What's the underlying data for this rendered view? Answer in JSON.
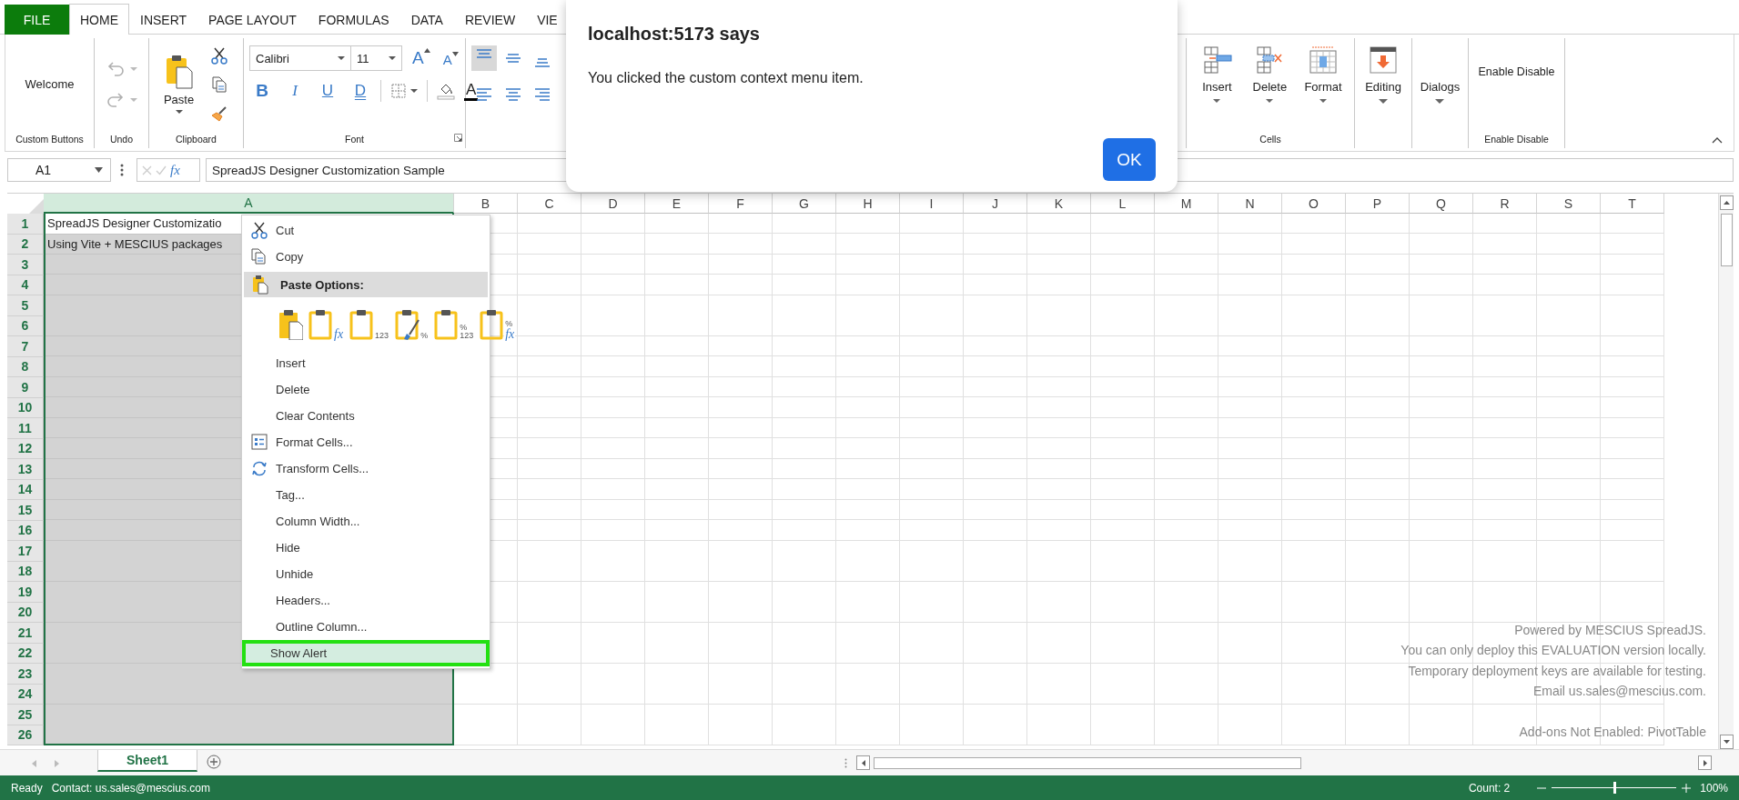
{
  "tabs": [
    {
      "label": "FILE",
      "kind": "file",
      "selected": false
    },
    {
      "label": "HOME",
      "kind": "tab",
      "selected": true
    },
    {
      "label": "INSERT",
      "kind": "tab",
      "selected": false
    },
    {
      "label": "PAGE LAYOUT",
      "kind": "tab",
      "selected": false
    },
    {
      "label": "FORMULAS",
      "kind": "tab",
      "selected": false
    },
    {
      "label": "DATA",
      "kind": "tab",
      "selected": false
    },
    {
      "label": "REVIEW",
      "kind": "tab",
      "selected": false
    },
    {
      "label": "VIE",
      "kind": "tab",
      "selected": false
    }
  ],
  "ribbon": {
    "groups": [
      {
        "kind": "custom",
        "label": "Custom Buttons",
        "button": "Welcome"
      },
      {
        "kind": "undo",
        "label": "Undo",
        "buttons": [
          {
            "kind": "undo",
            "disabled": true
          },
          {
            "kind": "redo",
            "disabled": true
          }
        ]
      },
      {
        "kind": "clipboard",
        "label": "Clipboard",
        "paste": "Paste"
      },
      {
        "kind": "font",
        "label": "Font",
        "font_name": "Calibri",
        "font_size": "11",
        "size_buttons": [
          {
            "kind": "grow",
            "text": "A"
          },
          {
            "kind": "shrink",
            "text": "A"
          }
        ],
        "style_buttons": [
          {
            "kind": "bold",
            "text": "B"
          },
          {
            "kind": "italic",
            "text": "I"
          },
          {
            "kind": "underline",
            "text": "U"
          },
          {
            "kind": "double-underline",
            "text": "D"
          }
        ],
        "font_color": "A"
      },
      {
        "kind": "alignment",
        "buttons": [
          {
            "kind": "top",
            "selected": true
          },
          {
            "kind": "middle",
            "selected": false
          },
          {
            "kind": "bottom",
            "selected": false
          },
          {
            "kind": "left",
            "selected": false
          },
          {
            "kind": "center",
            "selected": false
          },
          {
            "kind": "right",
            "selected": false
          }
        ]
      },
      {
        "kind": "cells",
        "label": "Cells",
        "buttons": [
          {
            "kind": "insert",
            "label": "Insert"
          },
          {
            "kind": "delete",
            "label": "Delete"
          },
          {
            "kind": "format",
            "label": "Format"
          }
        ]
      },
      {
        "kind": "icon-dropdown",
        "button": "Editing"
      },
      {
        "kind": "dropdown",
        "button": "Dialogs"
      },
      {
        "kind": "text",
        "label": "Enable Disable",
        "button": "Enable Disable"
      }
    ]
  },
  "formula_bar": {
    "name_box": "A1",
    "fx": "fx",
    "formula": "SpreadJS Designer Customization Sample"
  },
  "sheet": {
    "columns": [
      {
        "label": "A",
        "selected": true
      },
      {
        "label": "B",
        "selected": false
      },
      {
        "label": "C",
        "selected": false
      },
      {
        "label": "D",
        "selected": false
      },
      {
        "label": "E",
        "selected": false
      },
      {
        "label": "F",
        "selected": false
      },
      {
        "label": "G",
        "selected": false
      },
      {
        "label": "H",
        "selected": false
      },
      {
        "label": "I",
        "selected": false
      },
      {
        "label": "J",
        "selected": false
      },
      {
        "label": "K",
        "selected": false
      },
      {
        "label": "L",
        "selected": false
      },
      {
        "label": "M",
        "selected": false
      },
      {
        "label": "N",
        "selected": false
      },
      {
        "label": "O",
        "selected": false
      },
      {
        "label": "P",
        "selected": false
      },
      {
        "label": "Q",
        "selected": false
      },
      {
        "label": "R",
        "selected": false
      },
      {
        "label": "S",
        "selected": false
      },
      {
        "label": "T",
        "selected": false
      }
    ],
    "rows": [
      {
        "label": "1",
        "cells": [
          {
            "text": "SpreadJS Designer Customizatio",
            "active": true
          }
        ]
      },
      {
        "label": "2",
        "cells": [
          {
            "text": "Using Vite + MESCIUS packages",
            "active": false
          }
        ]
      },
      {
        "label": "3"
      },
      {
        "label": "4"
      },
      {
        "label": "5"
      },
      {
        "label": "6"
      },
      {
        "label": "7"
      },
      {
        "label": "8"
      },
      {
        "label": "9"
      },
      {
        "label": "10"
      },
      {
        "label": "11"
      },
      {
        "label": "12"
      },
      {
        "label": "13"
      },
      {
        "label": "14"
      },
      {
        "label": "15"
      },
      {
        "label": "16"
      },
      {
        "label": "17"
      },
      {
        "label": "18"
      },
      {
        "label": "19"
      },
      {
        "label": "20"
      },
      {
        "label": "21"
      },
      {
        "label": "22"
      },
      {
        "label": "23"
      },
      {
        "label": "24"
      },
      {
        "label": "25"
      },
      {
        "label": "26"
      }
    ],
    "notice": [
      "Powered by MESCIUS SpreadJS.",
      "You can only deploy this EVALUATION version locally.",
      "Temporary deployment keys are available for testing.",
      "Email us.sales@mescius.com."
    ],
    "addons": "Add-ons Not Enabled: PivotTable"
  },
  "sheet_tabs": [
    {
      "label": "Sheet1",
      "selected": true
    }
  ],
  "status_bar": {
    "state": "Ready",
    "contact": "Contact: us.sales@mescius.com",
    "count": "Count: 2",
    "zoom": {
      "level": 0.5
    },
    "zoom_label": "100%"
  },
  "context_menu": {
    "items": [
      {
        "kind": "cut",
        "label": "Cut",
        "selected": false
      },
      {
        "kind": "copy",
        "label": "Copy",
        "selected": false
      },
      {
        "kind": "header",
        "label": "Paste Options:"
      },
      {
        "kind": "paste-row",
        "options": [
          {
            "kind": "page"
          },
          {
            "kind": "plain",
            "marks": [
              "fx"
            ]
          },
          {
            "kind": "plain",
            "marks": [
              "123"
            ]
          },
          {
            "kind": "brush",
            "marks": [
              "%"
            ]
          },
          {
            "kind": "plain",
            "marks": [
              "%",
              "123"
            ]
          },
          {
            "kind": "plain",
            "marks": [
              "%",
              "fx"
            ]
          }
        ]
      },
      {
        "kind": "plain",
        "label": "Insert",
        "selected": false
      },
      {
        "kind": "plain",
        "label": "Delete",
        "selected": false
      },
      {
        "kind": "plain",
        "label": "Clear Contents",
        "selected": false
      },
      {
        "kind": "format-cells",
        "label": "Format Cells...",
        "selected": false
      },
      {
        "kind": "transform",
        "label": "Transform Cells...",
        "selected": false
      },
      {
        "kind": "plain",
        "label": "Tag...",
        "selected": false
      },
      {
        "kind": "plain",
        "label": "Column Width...",
        "selected": false
      },
      {
        "kind": "plain",
        "label": "Hide",
        "selected": false
      },
      {
        "kind": "plain",
        "label": "Unhide",
        "selected": false
      },
      {
        "kind": "plain",
        "label": "Headers...",
        "selected": false
      },
      {
        "kind": "plain",
        "label": "Outline Column...",
        "selected": false
      },
      {
        "kind": "plain",
        "label": "Show Alert",
        "selected": true
      }
    ]
  },
  "dialog": {
    "title": "localhost:5173 says",
    "message": "You clicked the custom context menu item.",
    "button": "OK"
  }
}
